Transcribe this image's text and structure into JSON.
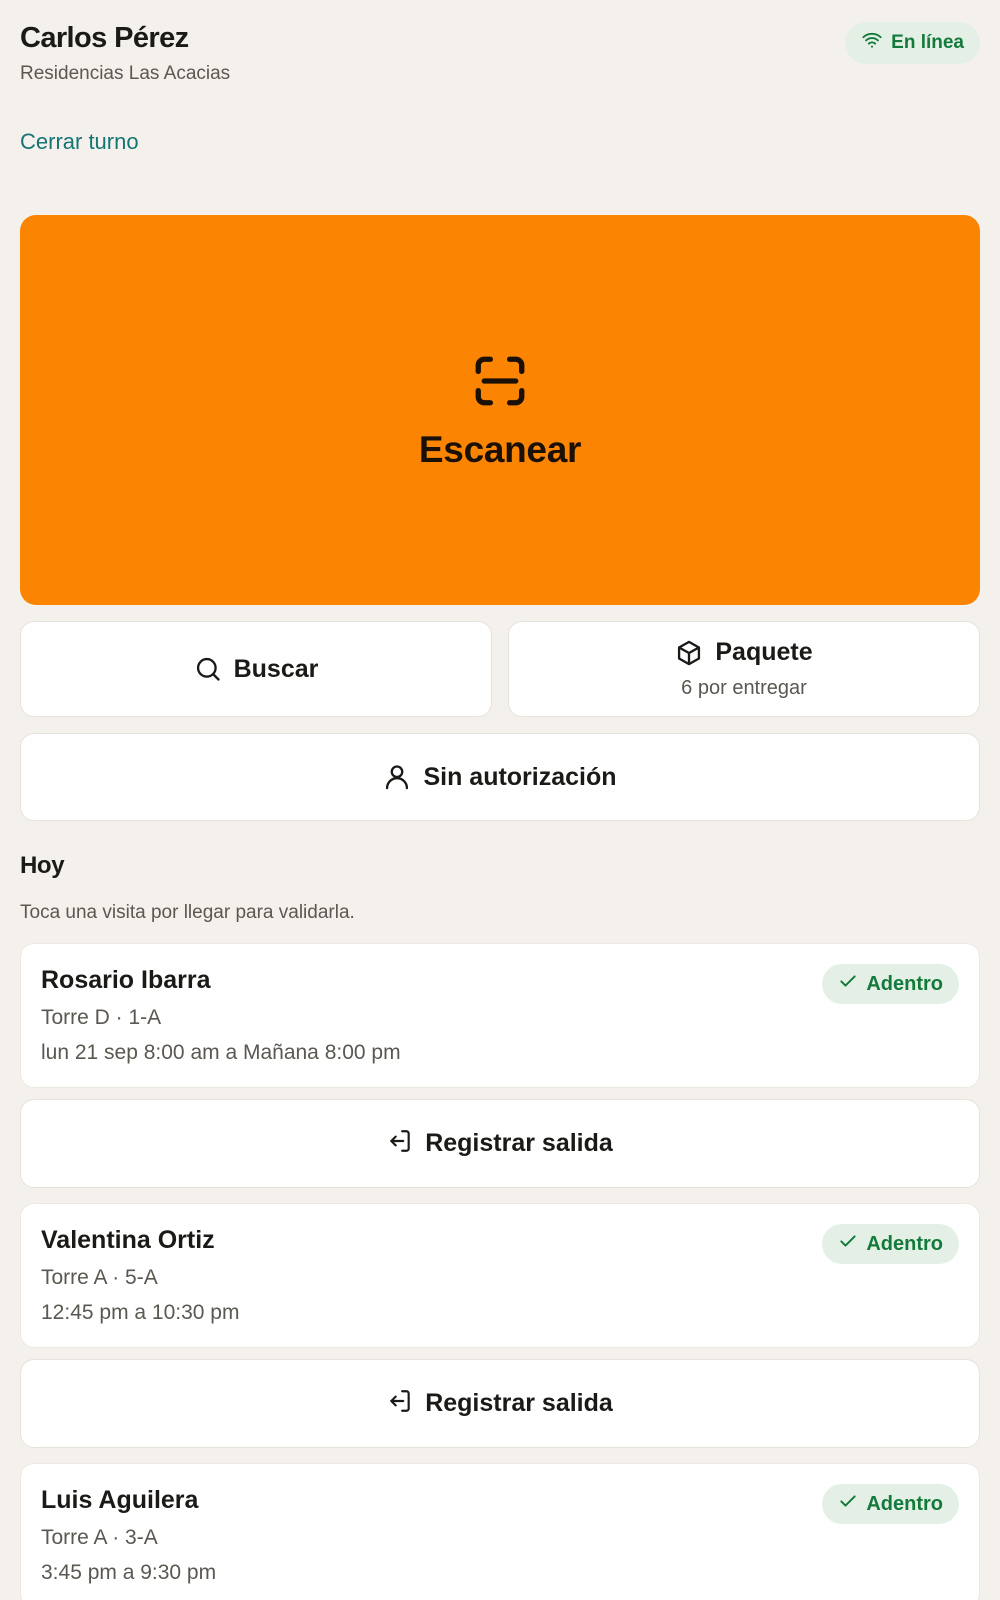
{
  "header": {
    "guard_name": "Carlos Pérez",
    "residence": "Residencias Las Acacias",
    "close_shift": "Cerrar turno",
    "status": {
      "label": "En línea",
      "icon": "wifi-icon",
      "color": "#147a3c"
    }
  },
  "scan": {
    "label": "Escanear",
    "icon": "scan-icon",
    "color": "#fb8502"
  },
  "actions": {
    "search": {
      "label": "Buscar",
      "icon": "search-icon"
    },
    "package": {
      "label": "Paquete",
      "subtitle": "6 por entregar",
      "icon": "package-icon"
    },
    "unauthorized": {
      "label": "Sin autorización",
      "icon": "user-icon"
    }
  },
  "today": {
    "title": "Hoy",
    "hint": "Toca una visita por llegar para validarla.",
    "visits": [
      {
        "name": "Rosario Ibarra",
        "unit": "Torre D · 1-A",
        "time": "lun 21 sep 8:00 am a Mañana 8:00 pm",
        "status": "Adentro",
        "exit_label": "Registrar salida"
      },
      {
        "name": "Valentina Ortiz",
        "unit": "Torre A · 5-A",
        "time": "12:45 pm a 10:30 pm",
        "status": "Adentro",
        "exit_label": "Registrar salida"
      },
      {
        "name": "Luis Aguilera",
        "unit": "Torre A · 3-A",
        "time": "3:45 pm a 9:30 pm",
        "status": "Adentro"
      }
    ]
  }
}
